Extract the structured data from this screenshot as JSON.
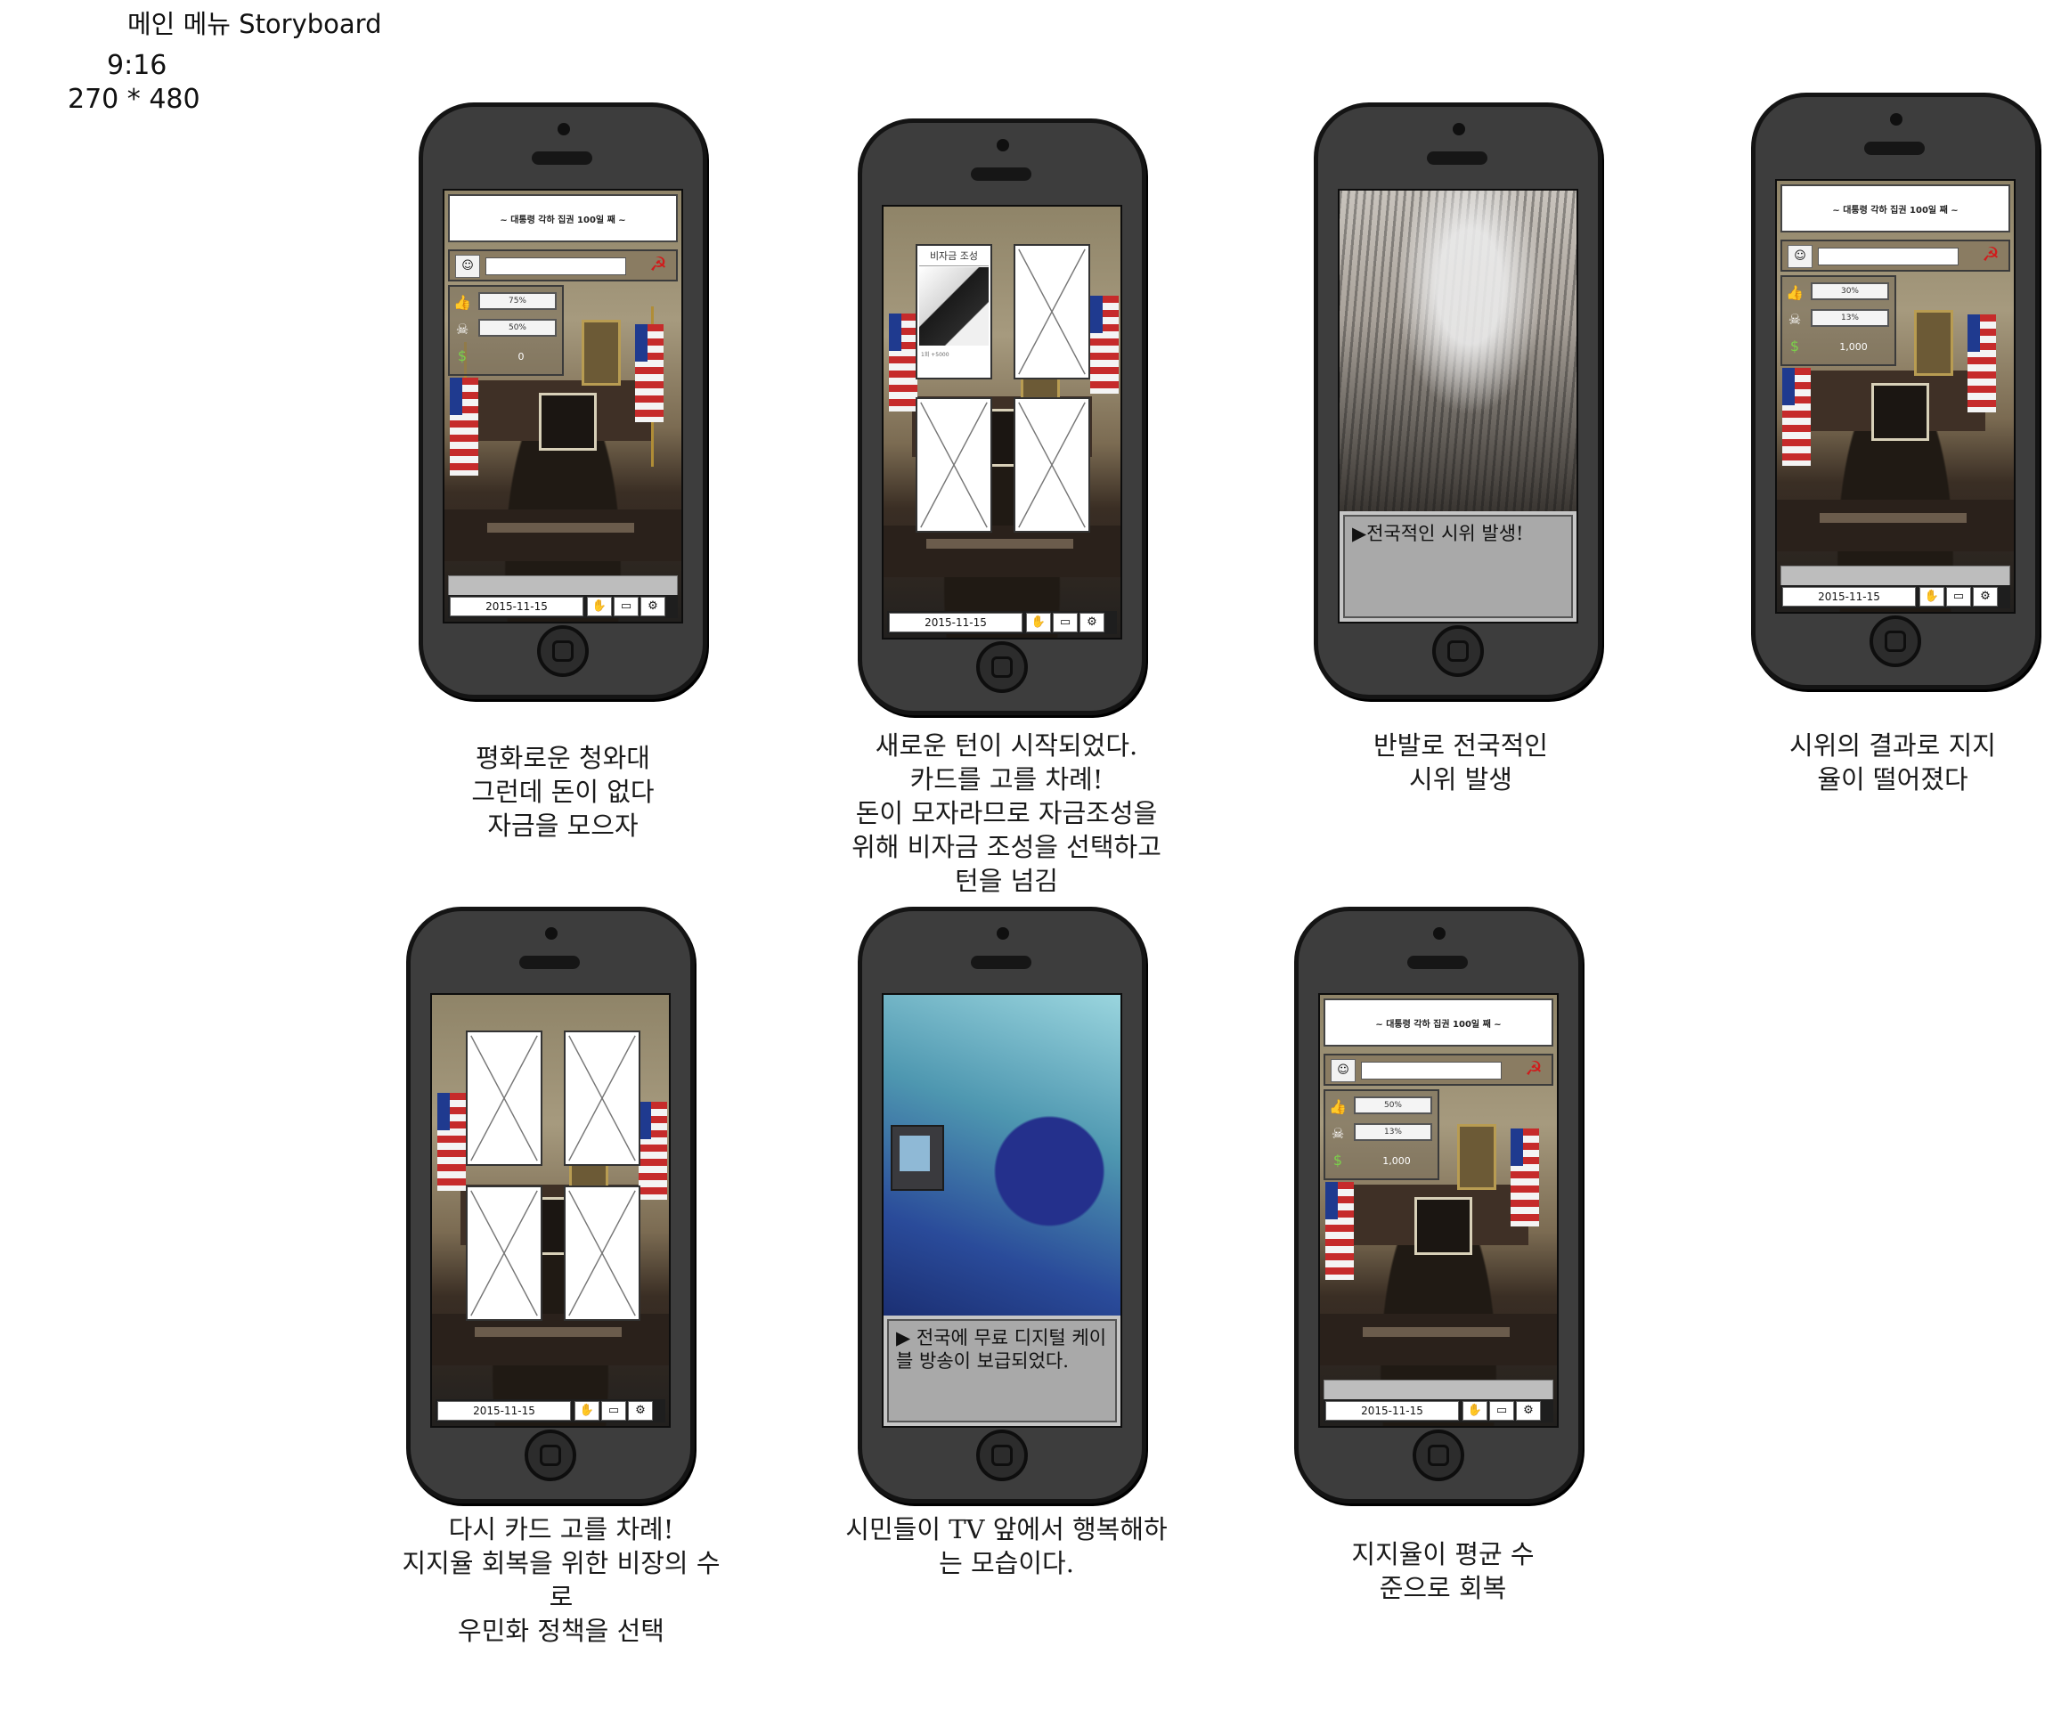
{
  "header": {
    "title": "메인 메뉴 Storyboard",
    "ratio": "9:16",
    "resolution": "270 * 480"
  },
  "hud": {
    "banner": "~ 대통령 각하 집권 100일 째 ~",
    "date": "2015-11-15",
    "sickle_icon": "hammer-sickle-icon",
    "tool_icons": [
      "hand-icon",
      "book-icon",
      "gear-icon"
    ]
  },
  "screens": [
    {
      "id": "s1",
      "stat1": "75%",
      "stat2": "50%",
      "money": "0",
      "caption": "평화로운 청와대\n그런데 돈이 없다\n자금을 모으자"
    },
    {
      "id": "s2",
      "card_label": "비자금 조성",
      "card_note": "1회 +5000",
      "caption": "새로운 턴이 시작되었다.\n카드를 고를 차례!\n돈이 모자라므로 자금조성을\n위해 비자금 조성을 선택하고\n턴을 넘김"
    },
    {
      "id": "s3",
      "event_text": "▶전국적인 시위 발생!",
      "caption": "반발로 전국적인\n시위 발생"
    },
    {
      "id": "s4",
      "stat1": "30%",
      "stat2": "13%",
      "money": "1,000",
      "caption": "시위의 결과로 지지\n율이 떨어졌다"
    },
    {
      "id": "s5",
      "caption": "다시 카드 고를 차례!\n지지율 회복을 위한 비장의 수\n로\n우민화 정책을 선택"
    },
    {
      "id": "s6",
      "event_text": "▶ 전국에 무료 디지털 케이블 방송이 보급되었다.",
      "caption": "시민들이 TV 앞에서 행복해하\n는 모습이다."
    },
    {
      "id": "s7",
      "stat1": "50%",
      "stat2": "13%",
      "money": "1,000",
      "caption": "지지율이 평균 수\n준으로 회복"
    }
  ]
}
